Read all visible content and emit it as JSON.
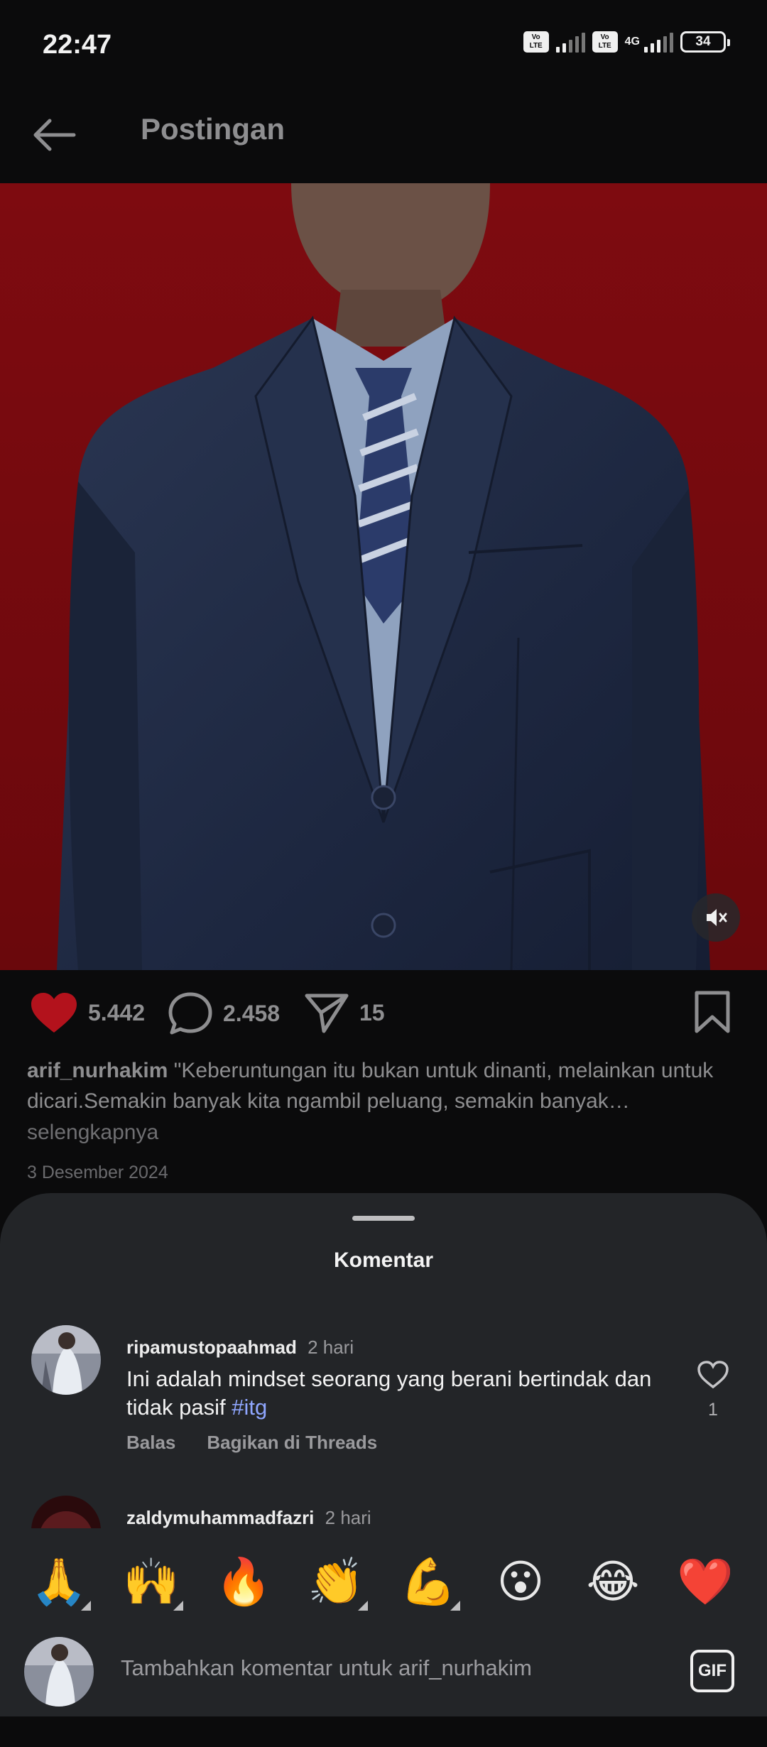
{
  "status_bar": {
    "time": "22:47",
    "volte_label": "Vo LTE",
    "network": "4G",
    "battery": "34"
  },
  "app_bar": {
    "title": "Postingan",
    "back_icon": "arrow-left-icon"
  },
  "post": {
    "image_description": "photo",
    "mute_icon": "speaker-muted-icon",
    "likes": "5.442",
    "comments": "2.458",
    "shares": "15",
    "author": "arif_nurhakim",
    "caption": "\"Keberuntungan itu bukan untuk dinanti, melainkan untuk dicari.Semakin banyak kita ngambil peluang, semakin banyak…",
    "more_label": "selengkapnya",
    "date": "3 Desember 2024",
    "liked_color": "#b3121c"
  },
  "comments_sheet": {
    "title": "Komentar",
    "comments": [
      {
        "user": "ripamustopaahmad",
        "time": "2 hari",
        "text": "Ini adalah mindset seorang yang berani bertindak dan tidak pasif ",
        "hashtag": "#itg",
        "reply_label": "Balas",
        "share_label": "Bagikan di Threads",
        "like_count": "1"
      },
      {
        "user": "zaldymuhammadfazri",
        "time": "2 hari"
      }
    ]
  },
  "composer": {
    "emojis": [
      "🙏",
      "🙌",
      "🔥",
      "👏",
      "💪",
      "😮",
      "😂",
      "❤️"
    ],
    "placeholder": "Tambahkan komentar untuk arif_nurhakim",
    "gif_label": "GIF"
  }
}
